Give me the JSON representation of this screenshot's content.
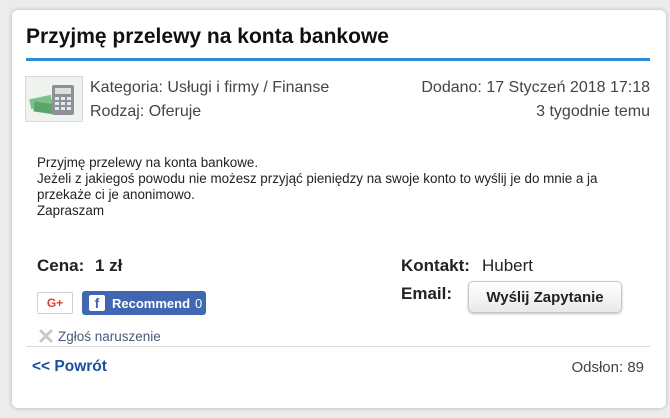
{
  "listing": {
    "title": "Przyjmę przelewy na konta bankowe",
    "category_label": "Kategoria:",
    "category_value": "Usługi i firmy / Finanse",
    "type_label": "Rodzaj:",
    "type_value": "Oferuje",
    "added": "Dodano: 17 Styczeń 2018 17:18",
    "added_relative": "3 tygodnie temu",
    "description_lines": [
      "Przyjmę przelewy na konta bankowe.",
      "Jeżeli z jakiegoś powodu nie możesz przyjąć pieniędzy na swoje konto to wyślij je do mnie a ja",
      "przekaże ci je anonimowo.",
      "Zapraszam"
    ],
    "price_label": "Cena:",
    "price_value": "1 zł",
    "contact_label": "Kontakt:",
    "contact_value": "Hubert",
    "email_label": "Email:",
    "send_button": "Wyślij Zapytanie"
  },
  "social": {
    "gplus_label": "G+",
    "fb_label": "Recommend",
    "fb_count": "0"
  },
  "footer": {
    "report_link": "Zgłoś naruszenie",
    "back_link": "<< Powrót",
    "views": "Odsłon: 89"
  },
  "icons": {
    "thumbnail": "calculator-icon",
    "report": "report-x-icon",
    "facebook": "facebook-icon",
    "google_plus": "google-plus-icon"
  },
  "colors": {
    "accent_rule": "#2b8fd6",
    "facebook": "#4267b2",
    "google_plus": "#d8412f",
    "link": "#1a4fa0"
  }
}
